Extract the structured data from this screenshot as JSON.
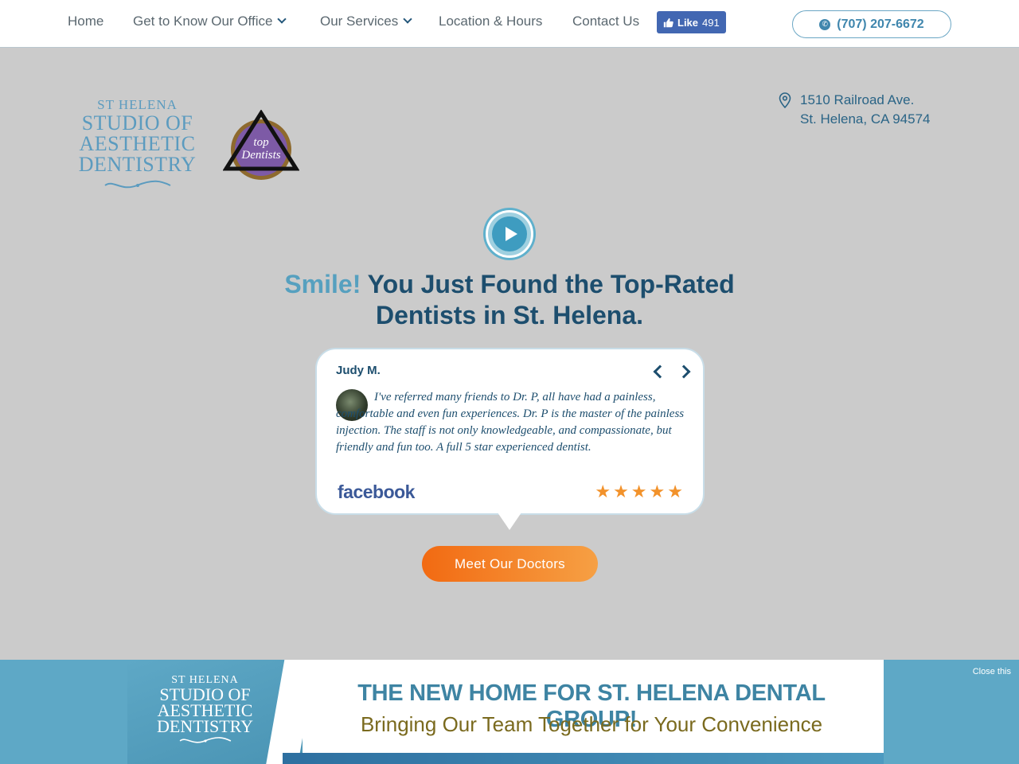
{
  "nav": {
    "items": [
      {
        "label": "Home"
      },
      {
        "label": "Get to Know Our Office"
      },
      {
        "label": "Our Services"
      },
      {
        "label": "Location & Hours"
      },
      {
        "label": "Contact Us"
      }
    ],
    "like_label": "Like",
    "like_count": "491",
    "phone": "(707) 207-6672"
  },
  "logo": {
    "line1": "ST HELENA",
    "line2": "STUDIO OF",
    "line3": "AESTHETIC",
    "line4": "DENTISTRY"
  },
  "badge": {
    "line1": "top",
    "line2": "Dentists"
  },
  "address": {
    "line1": "1510 Railroad Ave.",
    "line2": "St. Helena, CA 94574"
  },
  "hero": {
    "accent": "Smile!",
    "headline_rest": "You Just Found the Top-Rated",
    "headline_line2": "Dentists in St. Helena."
  },
  "review": {
    "name": "Judy M.",
    "text": "I've referred many friends to Dr. P, all have had a painless, comfortable and even fun experiences. Dr. P is the master of the painless injection. The staff is not only knowledgeable, and compassionate, but friendly and fun too. A full 5 star experienced dentist.",
    "source": "facebook",
    "rating": 5
  },
  "cta": {
    "label": "Meet Our Doctors"
  },
  "banner": {
    "logo_line1": "ST HELENA",
    "logo_line2": "STUDIO OF",
    "logo_line3": "AESTHETIC",
    "logo_line4": "DENTISTRY",
    "title": "THE NEW HOME FOR ST. HELENA DENTAL GROUP!",
    "subtitle": "Bringing Our Team Together for Your Convenience",
    "close_label": "Close this"
  },
  "colors": {
    "accent_blue": "#56a0bf",
    "navy": "#1d4e6e",
    "orange": "#f26a12",
    "facebook_blue": "#4267b2",
    "star_orange": "#f2922b"
  }
}
